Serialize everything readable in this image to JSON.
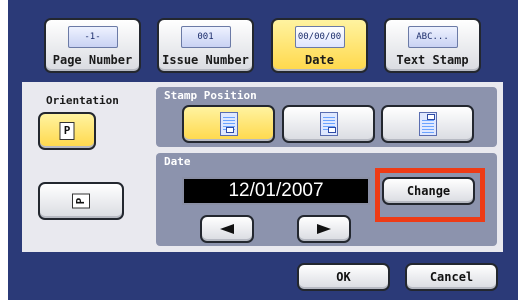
{
  "tabs": [
    {
      "chip": "-1-",
      "label": "Page Number",
      "selected": false
    },
    {
      "chip": "001",
      "label": "Issue Number",
      "selected": false
    },
    {
      "chip": "00/00/00",
      "label": "Date",
      "selected": true
    },
    {
      "chip": "ABC...",
      "label": "Text Stamp",
      "selected": false
    }
  ],
  "orientation": {
    "title": "Orientation",
    "options": [
      {
        "glyph": "P",
        "selected": true
      },
      {
        "glyph": "P",
        "selected": false
      }
    ]
  },
  "stamp_position": {
    "title": "Stamp Position",
    "options": [
      "bottom-center",
      "bottom-right",
      "top-right"
    ],
    "selected_index": 0
  },
  "date": {
    "title": "Date",
    "value": "12/01/2007",
    "change_label": "Change"
  },
  "footer": {
    "ok_label": "OK",
    "cancel_label": "Cancel"
  },
  "colors": {
    "panel": "#2b3a78",
    "highlight": "#ffd84a",
    "callout": "#ee3b16"
  }
}
